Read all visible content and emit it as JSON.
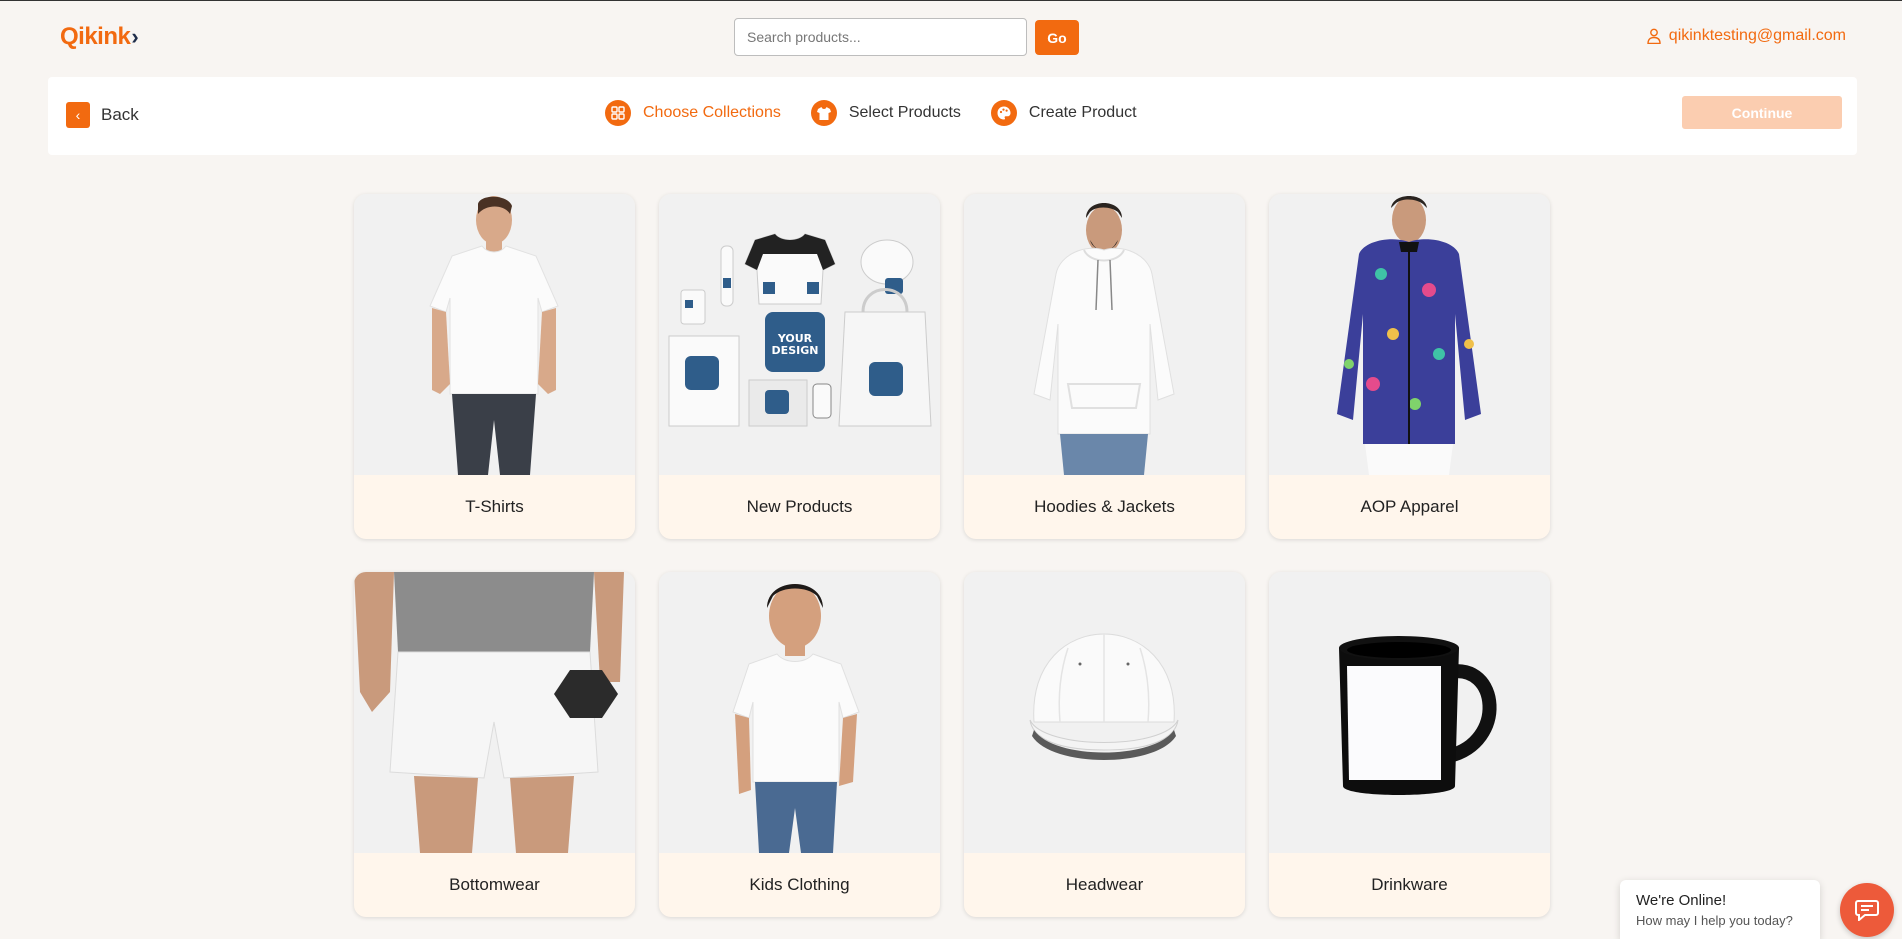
{
  "header": {
    "logo_text": "Qikink",
    "logo_chevron": "›",
    "search_placeholder": "Search products...",
    "search_value": "",
    "go_label": "Go",
    "account_email": "qikinktesting@gmail.com",
    "brand_color": "#f26a10"
  },
  "stepbar": {
    "back_label": "Back",
    "steps": [
      {
        "label": "Choose Collections",
        "icon": "grid-icon",
        "active": true
      },
      {
        "label": "Select Products",
        "icon": "tshirt-icon",
        "active": false
      },
      {
        "label": "Create Product",
        "icon": "palette-icon",
        "active": false
      }
    ],
    "continue_label": "Continue"
  },
  "collections": [
    {
      "name": "T-Shirts",
      "image": "man-white-tshirt"
    },
    {
      "name": "New Products",
      "image": "branded-merchandise-flatlay"
    },
    {
      "name": "Hoodies & Jackets",
      "image": "man-white-hoodie"
    },
    {
      "name": "AOP Apparel",
      "image": "man-printed-jacket"
    },
    {
      "name": "Bottomwear",
      "image": "man-white-shorts"
    },
    {
      "name": "Kids Clothing",
      "image": "boy-white-tshirt"
    },
    {
      "name": "Headwear",
      "image": "white-cap"
    },
    {
      "name": "Drinkware",
      "image": "black-mug"
    }
  ],
  "chat": {
    "title": "We're Online!",
    "subtitle": "How may I help you today?"
  }
}
